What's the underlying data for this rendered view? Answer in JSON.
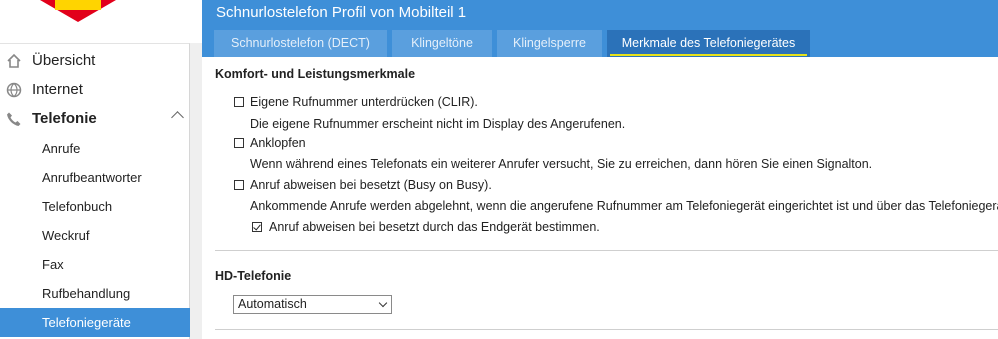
{
  "header": {
    "title": "Schnurlostelefon Profil von Mobilteil 1",
    "tabs": [
      {
        "label": "Schnurlostelefon (DECT)",
        "active": false
      },
      {
        "label": "Klingeltöne",
        "active": false
      },
      {
        "label": "Klingelsperre",
        "active": false
      },
      {
        "label": "Merkmale des Telefoniegerätes",
        "active": true
      }
    ]
  },
  "sidebar": {
    "items": [
      {
        "label": "Übersicht",
        "icon": "home-icon"
      },
      {
        "label": "Internet",
        "icon": "globe-icon"
      },
      {
        "label": "Telefonie",
        "icon": "phone-icon",
        "expanded": true
      }
    ],
    "subitems": [
      {
        "label": "Anrufe"
      },
      {
        "label": "Anrufbeantworter"
      },
      {
        "label": "Telefonbuch"
      },
      {
        "label": "Weckruf"
      },
      {
        "label": "Fax"
      },
      {
        "label": "Rufbehandlung"
      },
      {
        "label": "Telefoniegeräte",
        "active": true
      }
    ]
  },
  "comfort": {
    "title": "Komfort- und Leistungsmerkmale",
    "clir": {
      "label": "Eigene Rufnummer unterdrücken (CLIR).",
      "desc": "Die eigene Rufnummer erscheint nicht im Display des Angerufenen.",
      "checked": false
    },
    "knock": {
      "label": "Anklopfen",
      "desc": "Wenn während eines Telefonats ein weiterer Anrufer versucht, Sie zu erreichen, dann hören Sie einen Signalton.",
      "checked": false
    },
    "busy": {
      "label": "Anruf abweisen bei besetzt (Busy on Busy).",
      "desc": "Ankommende Anrufe werden abgelehnt, wenn die angerufene Rufnummer am Telefoniegerät eingerichtet ist und über das Telefoniegerät bere",
      "checked": false
    },
    "busy_device": {
      "label": "Anruf abweisen bei besetzt durch das Endgerät bestimmen.",
      "checked": true
    }
  },
  "hd": {
    "title": "HD-Telefonie",
    "select_value": "Automatisch"
  },
  "colors": {
    "accent": "#3e8fd8",
    "tab_active": "#2b72b9",
    "tab_underline": "#e6e21c"
  }
}
